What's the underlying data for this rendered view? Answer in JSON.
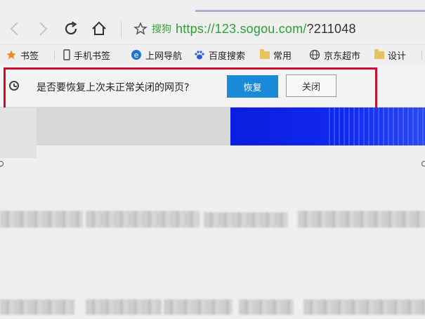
{
  "browser": {
    "search_provider": "搜狗",
    "url_domain": "https://123.sogou.com/",
    "url_query": "?211048"
  },
  "bookmarks": [
    {
      "label": "书签",
      "icon": "star-icon"
    },
    {
      "label": "手机书签",
      "icon": "phone-icon"
    },
    {
      "label": "上网导航",
      "icon": "ie-icon"
    },
    {
      "label": "百度搜索",
      "icon": "baidu-paw-icon"
    },
    {
      "label": "常用",
      "icon": "folder-icon"
    },
    {
      "label": "京东超市",
      "icon": "globe-icon"
    },
    {
      "label": "设计",
      "icon": "folder-icon"
    }
  ],
  "restore_prompt": {
    "message": "是否要恢复上次未正常关闭的网页?",
    "restore_label": "恢复",
    "close_label": "关闭"
  },
  "colors": {
    "accent_blue": "#1a8ad8",
    "highlight_red": "#c8102e",
    "url_green": "#2e9f35",
    "banner_blue": "#1129f0"
  }
}
